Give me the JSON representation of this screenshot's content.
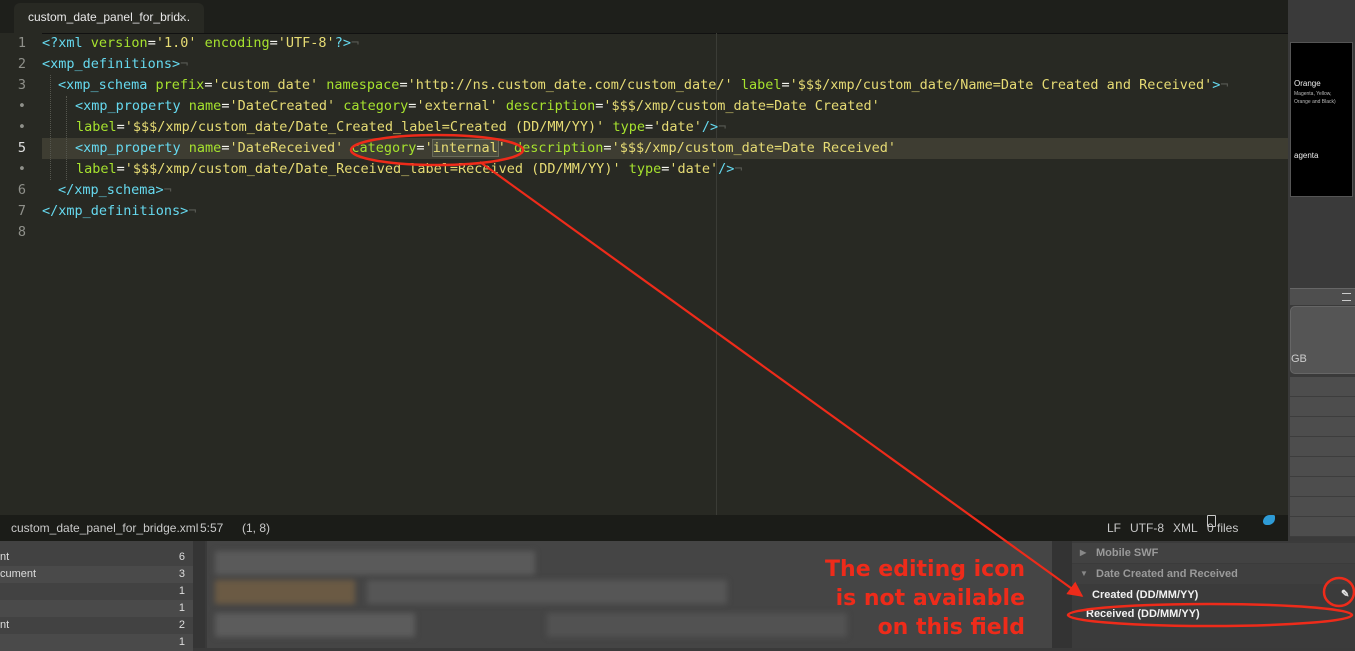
{
  "editor": {
    "tab_title": "custom_date_panel_for_brid...",
    "tab_close": "×",
    "line_numbers": [
      "1",
      "2",
      "3",
      "•",
      "5",
      "•",
      "6",
      "7",
      "8"
    ],
    "lines": {
      "l1": {
        "c1": "<?xml ",
        "c2": "version",
        "c3": "=",
        "c4": "'1.0'",
        "c5": " ",
        "c6": "encoding",
        "c7": "=",
        "c8": "'UTF-8'",
        "c9": "?>",
        "c10": "¬"
      },
      "l2": {
        "c1": "<xmp_definitions>",
        "c2": "¬"
      },
      "l3": {
        "c1": "<xmp_schema ",
        "c2": "prefix",
        "c3": "=",
        "c4": "'custom_date'",
        "c5": " ",
        "c6": "namespace",
        "c7": "=",
        "c8": "'http://ns.custom_date.com/custom_date/'",
        "c9": " ",
        "c10": "label",
        "c11": "=",
        "c12": "'$$$/xmp/custom_date/Name=Date Created and Received'",
        "c13": ">",
        "c14": "¬"
      },
      "l4": {
        "c1": "<xmp_property ",
        "c2": "name",
        "c3": "=",
        "c4": "'DateCreated'",
        "c5": " ",
        "c6": "category",
        "c7": "=",
        "c8": "'external'",
        "c9": " ",
        "c10": "description",
        "c11": "=",
        "c12": "'$$$/xmp/custom_date=Date Created'"
      },
      "l4b": {
        "c1": "label",
        "c2": "=",
        "c3": "'$$$/xmp/custom_date/Date_Created_label=Created (DD/MM/YY)'",
        "c4": " ",
        "c5": "type",
        "c6": "=",
        "c7": "'date'",
        "c8": "/>",
        "c9": "¬"
      },
      "l5": {
        "c1": "<xmp_property ",
        "c2": "name",
        "c3": "=",
        "c4": "'DateReceived'",
        "c5": " ",
        "c6": "category",
        "c7": "=",
        "c8": "'",
        "c9": "internal",
        "c10": "'",
        "c11": " ",
        "c12": "description",
        "c13": "=",
        "c14": "'$$$/xmp/custom_date=Date Received'"
      },
      "l5b": {
        "c1": "label",
        "c2": "=",
        "c3": "'$$$/xmp/custom_date/Date_Received_label=Received (DD/MM/YY)'",
        "c4": " ",
        "c5": "type",
        "c6": "=",
        "c7": "'date'",
        "c8": "/>",
        "c9": "¬"
      },
      "l6": {
        "c1": "</xmp_schema>",
        "c2": "¬"
      },
      "l7": {
        "c1": "</xmp_definitions>",
        "c2": "¬"
      }
    }
  },
  "statusbar": {
    "filename": "custom_date_panel_for_bridge.xml",
    "position": "5:57",
    "selection": "(1, 8)",
    "line_ending": "LF",
    "encoding": "UTF-8",
    "syntax": "XML",
    "files": "0 files"
  },
  "preview": {
    "t1": "Orange",
    "t2": "Magenta, Yellow,",
    "t3": "Orange and Black)",
    "t4": "agenta"
  },
  "right_card": {
    "label": "GB"
  },
  "metadata_panel": {
    "section_mobile": "Mobile SWF",
    "section_date": "Date Created and Received",
    "field_created": "Created (DD/MM/YY)",
    "field_received": "Received (DD/MM/YY)"
  },
  "left_panel": {
    "rows": [
      {
        "label": "nt",
        "count": "6"
      },
      {
        "label": "cument",
        "count": "3"
      },
      {
        "label": "",
        "count": "1"
      },
      {
        "label": "",
        "count": "1"
      },
      {
        "label": "nt",
        "count": "2"
      },
      {
        "label": "",
        "count": "1"
      }
    ]
  },
  "annotation": {
    "line1": "The editing icon",
    "line2": "is not available",
    "line3": "on this field"
  },
  "colors": {
    "editor_bg": "#282923",
    "tag": "#66d9ef",
    "attribute": "#a6e22e",
    "string": "#e6db74",
    "annotation_red": "#ee2b1a"
  }
}
